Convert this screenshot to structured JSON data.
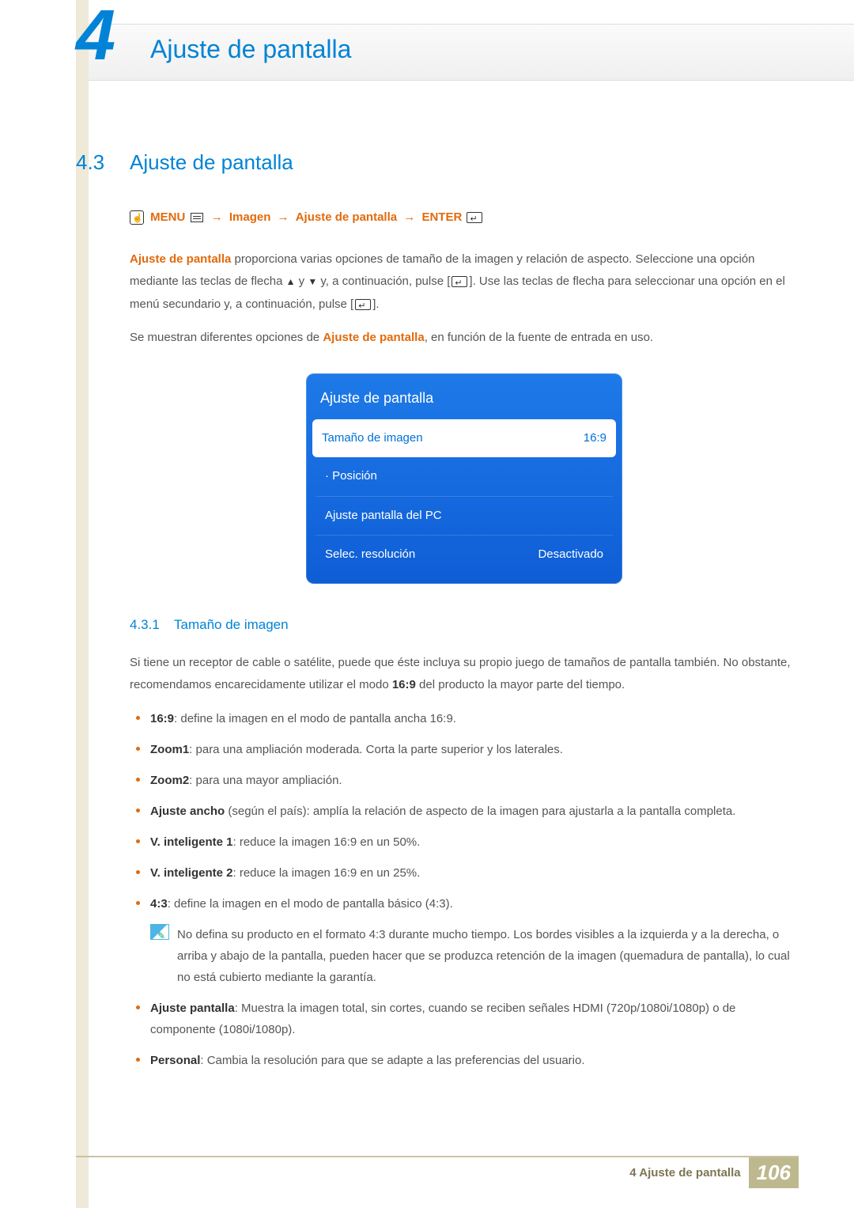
{
  "header": {
    "chapter_num": "4",
    "chapter_title": "Ajuste de pantalla"
  },
  "section": {
    "num": "4.3",
    "title": "Ajuste de pantalla"
  },
  "nav": {
    "menu": "MENU",
    "p1": "Imagen",
    "p2": "Ajuste de pantalla",
    "enter": "ENTER",
    "arrow": "→"
  },
  "intro": {
    "line1_lead": "Ajuste de pantalla",
    "line1_rest": " proporciona varias opciones de tamaño de la imagen y relación de aspecto. ",
    "line2a": "Seleccione una opción mediante las teclas de flecha ",
    "line2b": " y ",
    "line2c": " y, a continuación, pulse [",
    "line2d": "]. Use las teclas de flecha para seleccionar una opción en el menú secundario y, a continuación, pulse [",
    "line2e": "].",
    "line3a": "Se muestran diferentes opciones de ",
    "line3_lead": "Ajuste de pantalla",
    "line3b": ", en función de la fuente de entrada en uso."
  },
  "osd": {
    "title": "Ajuste de pantalla",
    "rows": [
      {
        "label": "Tamaño de imagen",
        "value": "16:9",
        "selected": true
      },
      {
        "label": "· Posición",
        "value": "",
        "selected": false
      },
      {
        "label": "Ajuste pantalla del PC",
        "value": "",
        "selected": false
      },
      {
        "label": "Selec. resolución",
        "value": "Desactivado",
        "selected": false
      }
    ]
  },
  "subsection": {
    "num": "4.3.1",
    "title": "Tamaño de imagen",
    "intro_a": "Si tiene un receptor de cable o satélite, puede que éste incluya su propio juego de tamaños de pantalla también. No obstante, recomendamos encarecidamente utilizar el modo ",
    "intro_b": "16:9",
    "intro_c": " del producto la mayor parte del tiempo."
  },
  "bullets": [
    {
      "lead": "16:9",
      "rest": ": define la imagen en el modo de pantalla ancha 16:9."
    },
    {
      "lead": "Zoom1",
      "rest": ": para una ampliación moderada. Corta la parte superior y los laterales."
    },
    {
      "lead": "Zoom2",
      "rest": ": para una mayor ampliación."
    },
    {
      "lead": "Ajuste ancho",
      "rest": " (según el país): amplía la relación de aspecto de la imagen para ajustarla a la pantalla completa."
    },
    {
      "lead": "V. inteligente 1",
      "rest": ": reduce la imagen 16:9 en un 50%."
    },
    {
      "lead": "V. inteligente 2",
      "rest": ": reduce la imagen 16:9 en un 25%."
    },
    {
      "lead": "4:3",
      "rest": ": define la imagen en el modo de pantalla básico (4:3)."
    }
  ],
  "note": "No defina su producto en el formato 4:3 durante mucho tiempo. Los bordes visibles a la izquierda y a la derecha, o arriba y abajo de la pantalla, pueden hacer que se produzca retención de la imagen (quemadura de pantalla), lo cual no está cubierto mediante la garantía.",
  "bullets2": [
    {
      "lead": "Ajuste pantalla",
      "rest": ": Muestra la imagen total, sin cortes, cuando se reciben señales HDMI (720p/1080i/1080p) o de componente (1080i/1080p)."
    },
    {
      "lead": "Personal",
      "rest": ": Cambia la resolución para que se adapte a las preferencias del usuario."
    }
  ],
  "footer": {
    "text": "4 Ajuste de pantalla",
    "page": "106"
  },
  "arrows": {
    "up": "▲",
    "down": "▼"
  }
}
